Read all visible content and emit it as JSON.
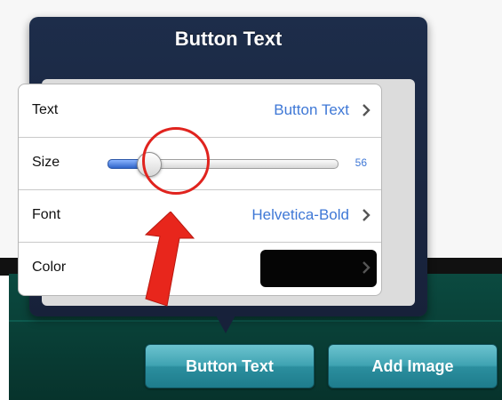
{
  "popover": {
    "title": "Button Text",
    "rows": [
      {
        "label": "Text",
        "value": "Button Text"
      },
      {
        "label": "Size",
        "value": "56",
        "slider_fraction": 0.12
      },
      {
        "label": "Font",
        "value": "Helvetica-Bold"
      },
      {
        "label": "Color",
        "swatch_color": "#050505"
      }
    ]
  },
  "toolbar": {
    "button_text_label": "Button Text",
    "add_image_label": "Add Image"
  },
  "icons": [
    "chevron-right-icon",
    "red-arrow-annotation",
    "red-circle-annotation"
  ],
  "colors": {
    "popover_bg": "#1d2d4a",
    "value_blue": "#3f78d6",
    "annotation_red": "#e0231e",
    "button_teal": "#3fa3b2",
    "background_teal": "#0b4a40"
  }
}
